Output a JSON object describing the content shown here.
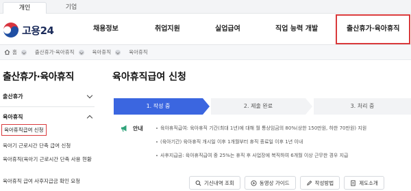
{
  "user_tabs": [
    "개인",
    "기업"
  ],
  "logo": {
    "text": "고용24"
  },
  "gnb": [
    "채용정보",
    "취업지원",
    "실업급여",
    "직업 능력 개발",
    "출산휴가·육아휴직"
  ],
  "breadcrumb": [
    "홈",
    "출산휴가·육아휴직",
    "육아휴직",
    "육아휴직"
  ],
  "side": {
    "title": "출산휴가·육아휴직",
    "menu1": "출산휴가",
    "menu2": "육아휴직",
    "subs": [
      "육아휴직급여 신청",
      "육아기 근로시간 단축 급여 신청",
      "육아휴직(육아기 근로시간 단축 사용 현황",
      "육아휴직 급여 사후지급금 확인 요청"
    ]
  },
  "main": {
    "title": "육아휴직급여 신청",
    "steps": [
      "1. 작성 중",
      "2. 제출 완료",
      "3. 처리 중"
    ],
    "info_label": "안내",
    "info_lines": [
      "육아휴직급여: 육아휴직 기간(최대 1년)에 대해 월 통상임금의 80%(상한 150만원, 하한 70만원) 지원",
      "(육아기간) 육아휴직 개시일 이후 1개월부터 휴직 종료일 이후 1년 이내",
      "사후지급금: 육아휴직급여 중 25%는 휴직 후 사업장에 복직하여 6개월 이상 근무한 경우 지급"
    ],
    "buttons": [
      "기신내역 조회",
      "동영상 가이드",
      "작성방법",
      "제도소개"
    ]
  },
  "colors": {
    "accent": "#3b66e0",
    "highlight": "#d9383a",
    "navy": "#1b2b5a"
  }
}
